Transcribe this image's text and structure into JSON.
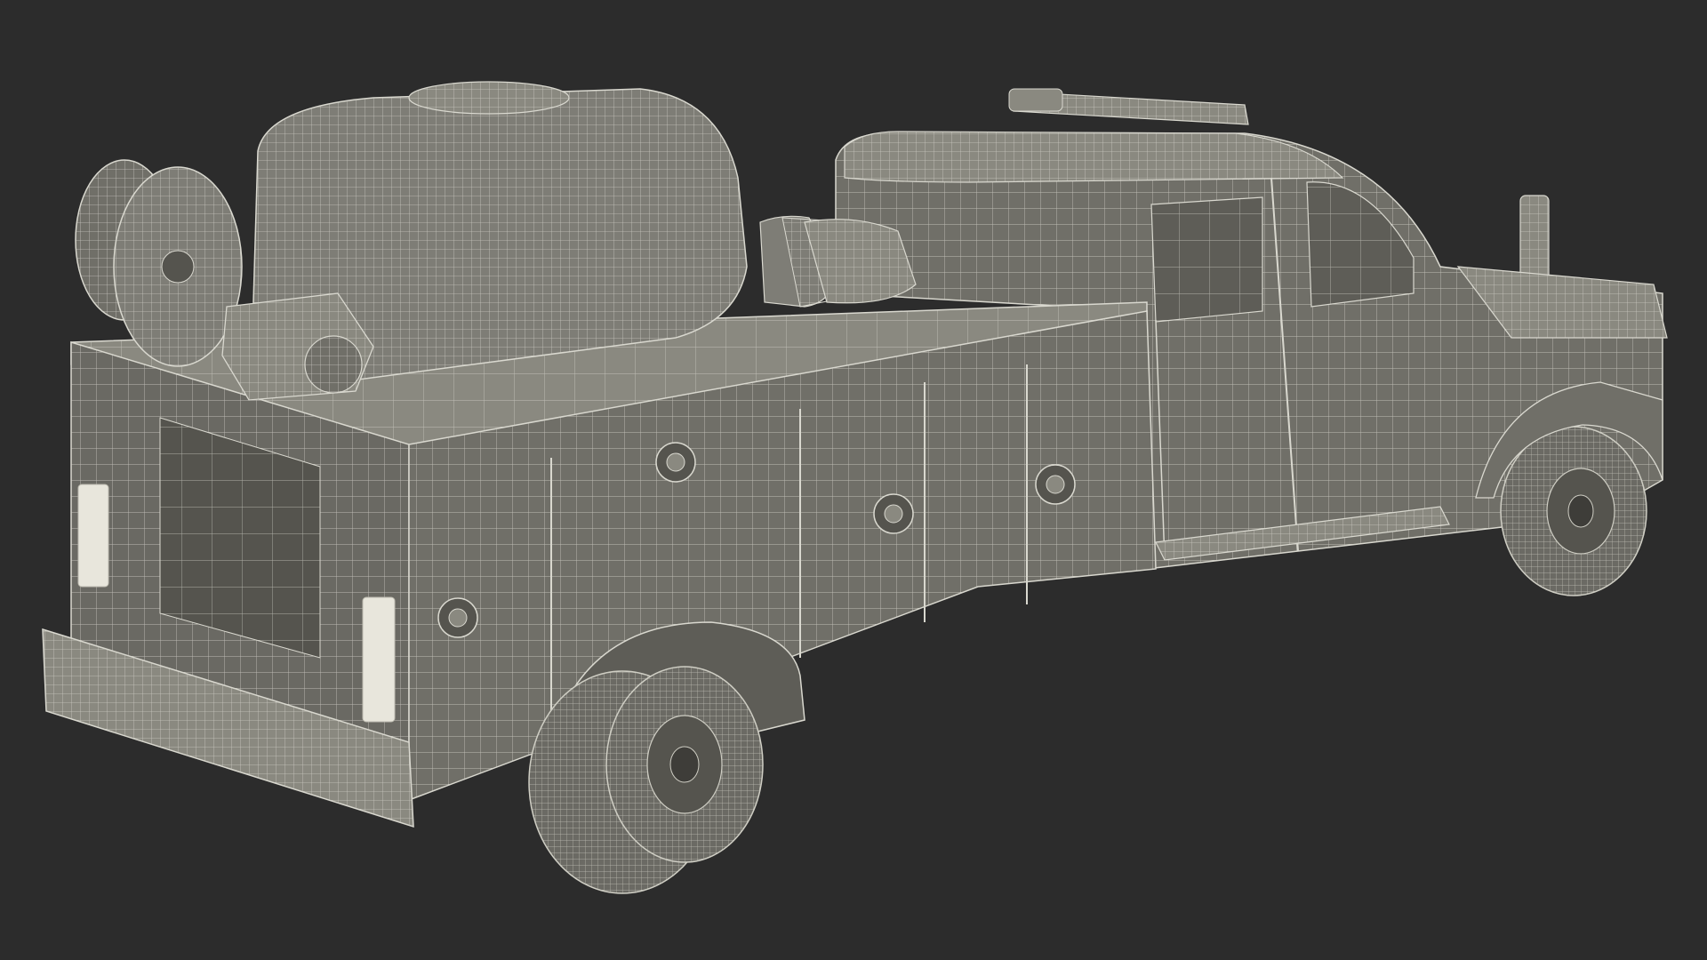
{
  "scene": {
    "subject": "fire-rescue-utility-truck-wireframe-render",
    "colors": {
      "background": "#2c2c2c",
      "body": "#706f68",
      "body_light": "#8a8980",
      "body_dark": "#55544e",
      "wire": "#d9d8cf",
      "tire": "#6b6a64",
      "tire_wire": "#cfcec4"
    }
  }
}
